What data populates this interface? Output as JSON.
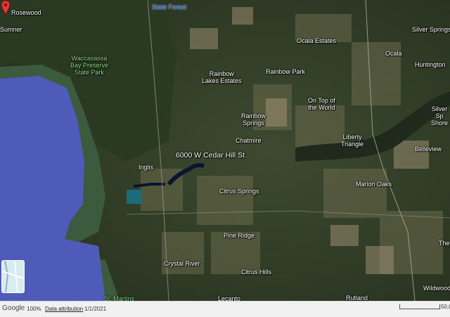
{
  "map": {
    "type": "satellite",
    "address_label": "6000 W Cedar Hill St",
    "pin_color": "#e53935",
    "water_color": "#4f5bb8",
    "places": {
      "rosewood": "Rosewood",
      "sumner": "Sumner",
      "state_forest": "State Forest",
      "preserve": "Waccasassa\nBay Preserve\nState Park",
      "rainbow_lakes": "Rainbow\nLakes Estates",
      "rainbow_park": "Rainbow Park",
      "ocala_estates": "Ocala Estates",
      "silver_springs": "Silver Springs",
      "ocala": "Ocala",
      "huntington": "Huntington",
      "on_top": "On Top of\nthe World",
      "silver_shores": "Silver Sp\nShore",
      "rainbow_springs": "Rainbow\nSprings",
      "liberty": "Liberty\nTriangle",
      "chatmire": "Chatmire",
      "belleview": "Belleview",
      "inglis": "Inglis",
      "citrus_springs": "Citrus Springs",
      "marion_oaks": "Marion Oaks",
      "pine_ridge": "Pine Ridge",
      "crystal_river": "Crystal River",
      "citrus_hills": "Citrus Hills",
      "st_martins": "St. Martins",
      "rutland": "Rutland",
      "wildwood": "Wildwood",
      "lecanto": "Lecanto",
      "edge_the": "The"
    }
  },
  "statusbar": {
    "brand": "Google",
    "zoom": "100%",
    "attribution": "Data attribution",
    "date": "1/1/2021",
    "scale": "50,0"
  }
}
